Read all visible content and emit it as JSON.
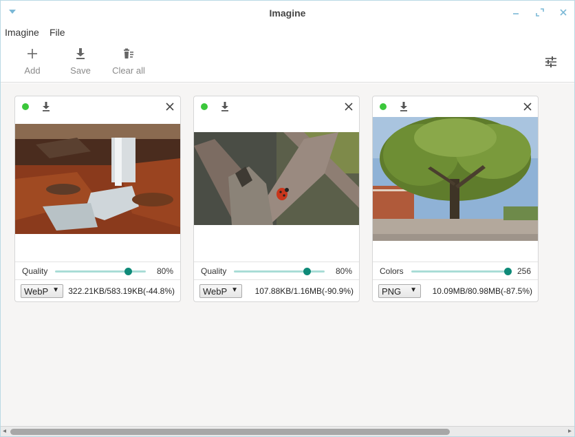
{
  "window": {
    "title": "Imagine"
  },
  "menu": {
    "items": [
      "Imagine",
      "File"
    ]
  },
  "toolbar": {
    "add_label": "Add",
    "save_label": "Save",
    "clear_label": "Clear all"
  },
  "cards": [
    {
      "slider_label": "Quality",
      "slider_value_text": "80%",
      "slider_fraction": 0.8,
      "format": "WebP",
      "size_text": "322.21KB/583.19KB(-44.8%)",
      "image": "waterfall-autumn-forest"
    },
    {
      "slider_label": "Quality",
      "slider_value_text": "80%",
      "slider_fraction": 0.8,
      "format": "WebP",
      "size_text": "107.88KB/1.16MB(-90.9%)",
      "image": "ladybug-on-branch"
    },
    {
      "slider_label": "Colors",
      "slider_value_text": "256",
      "slider_fraction": 1.0,
      "format": "PNG",
      "size_text": "10.09MB/80.98MB(-87.5%)",
      "image": "large-tree-town-square"
    }
  ],
  "colors": {
    "status_ok": "#3bc73b",
    "slider_track": "#a9dcd6",
    "slider_knob": "#0e8a78",
    "titlebar_controls": "#7ab8d6"
  },
  "icons": {
    "add": "plus-icon",
    "save": "download-icon",
    "clear": "trash-list-icon",
    "settings": "sliders-icon",
    "card_download": "download-icon",
    "card_close": "close-icon"
  }
}
